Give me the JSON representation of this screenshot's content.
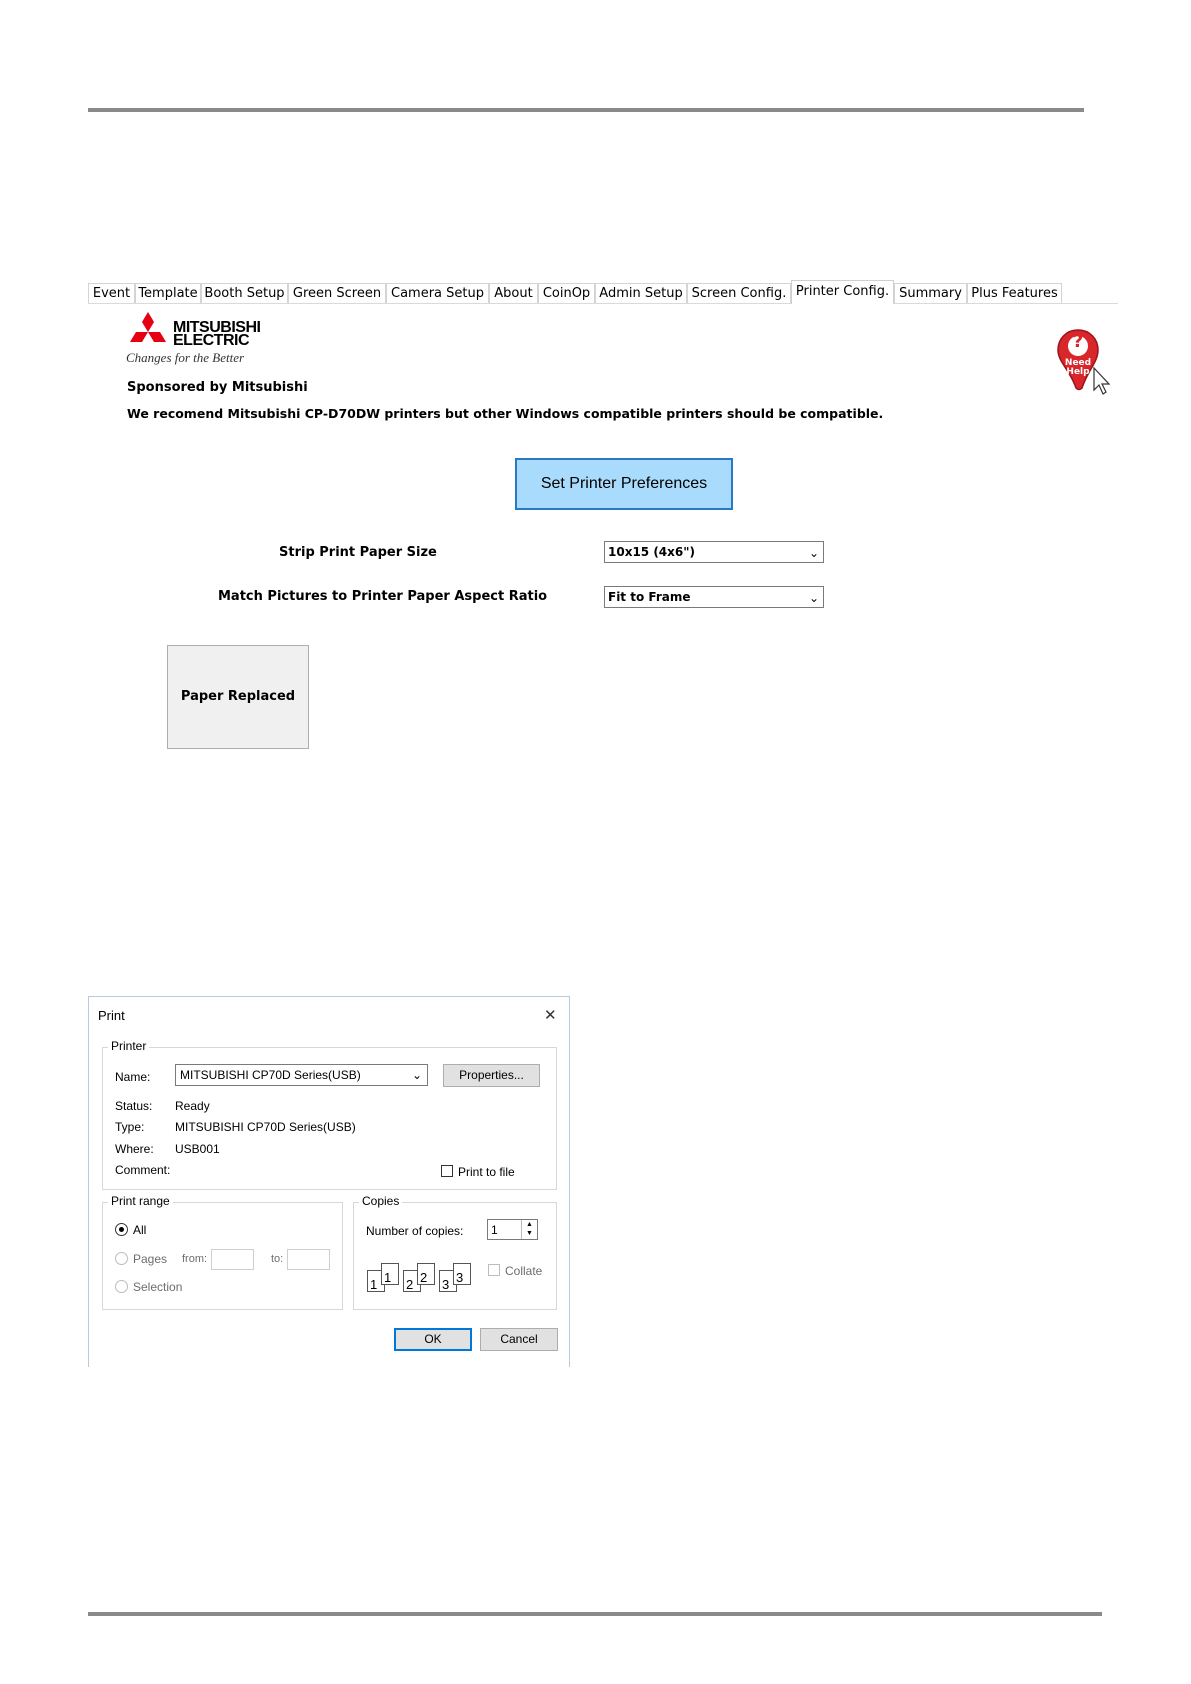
{
  "tabs": [
    {
      "label": "Event"
    },
    {
      "label": "Template"
    },
    {
      "label": "Booth Setup"
    },
    {
      "label": "Green Screen"
    },
    {
      "label": "Camera Setup"
    },
    {
      "label": "About"
    },
    {
      "label": "CoinOp"
    },
    {
      "label": "Admin Setup"
    },
    {
      "label": "Screen Config."
    },
    {
      "label": "Printer Config.",
      "active": true
    },
    {
      "label": "Summary"
    },
    {
      "label": "Plus Features"
    }
  ],
  "logo": {
    "line1": "MITSUBISHI",
    "line2": "ELECTRIC",
    "tagline": "Changes for the Better",
    "color": "#e60012"
  },
  "help": {
    "line1": "Need",
    "line2": "Help",
    "mark": "?",
    "color": "#d9262b"
  },
  "sponsor_text": "Sponsored by Mitsubishi",
  "recommend_text": "We recomend Mitsubishi CP-D70DW printers but other Windows compatible printers should be compatible.",
  "set_pref_button": "Set Printer Preferences",
  "strip_size": {
    "label": "Strip Print Paper Size",
    "value": "10x15 (4x6\")"
  },
  "aspect": {
    "label": "Match Pictures to Printer Paper Aspect Ratio",
    "value": "Fit to Frame"
  },
  "paper_replaced_button": "Paper Replaced",
  "print_dialog": {
    "title": "Print",
    "close": "✕",
    "printer_group": "Printer",
    "name_label": "Name:",
    "name_value": "MITSUBISHI CP70D Series(USB)",
    "properties_button": "Properties...",
    "status_label": "Status:",
    "status_value": "Ready",
    "type_label": "Type:",
    "type_value": "MITSUBISHI CP70D Series(USB)",
    "where_label": "Where:",
    "where_value": "USB001",
    "comment_label": "Comment:",
    "print_to_file": "Print to file",
    "range_group": "Print range",
    "all": "All",
    "pages": "Pages",
    "from": "from:",
    "to": "to:",
    "selection": "Selection",
    "copies_group": "Copies",
    "copies_label": "Number of copies:",
    "copies_value": "1",
    "collate": "Collate",
    "ok": "OK",
    "cancel": "Cancel"
  }
}
